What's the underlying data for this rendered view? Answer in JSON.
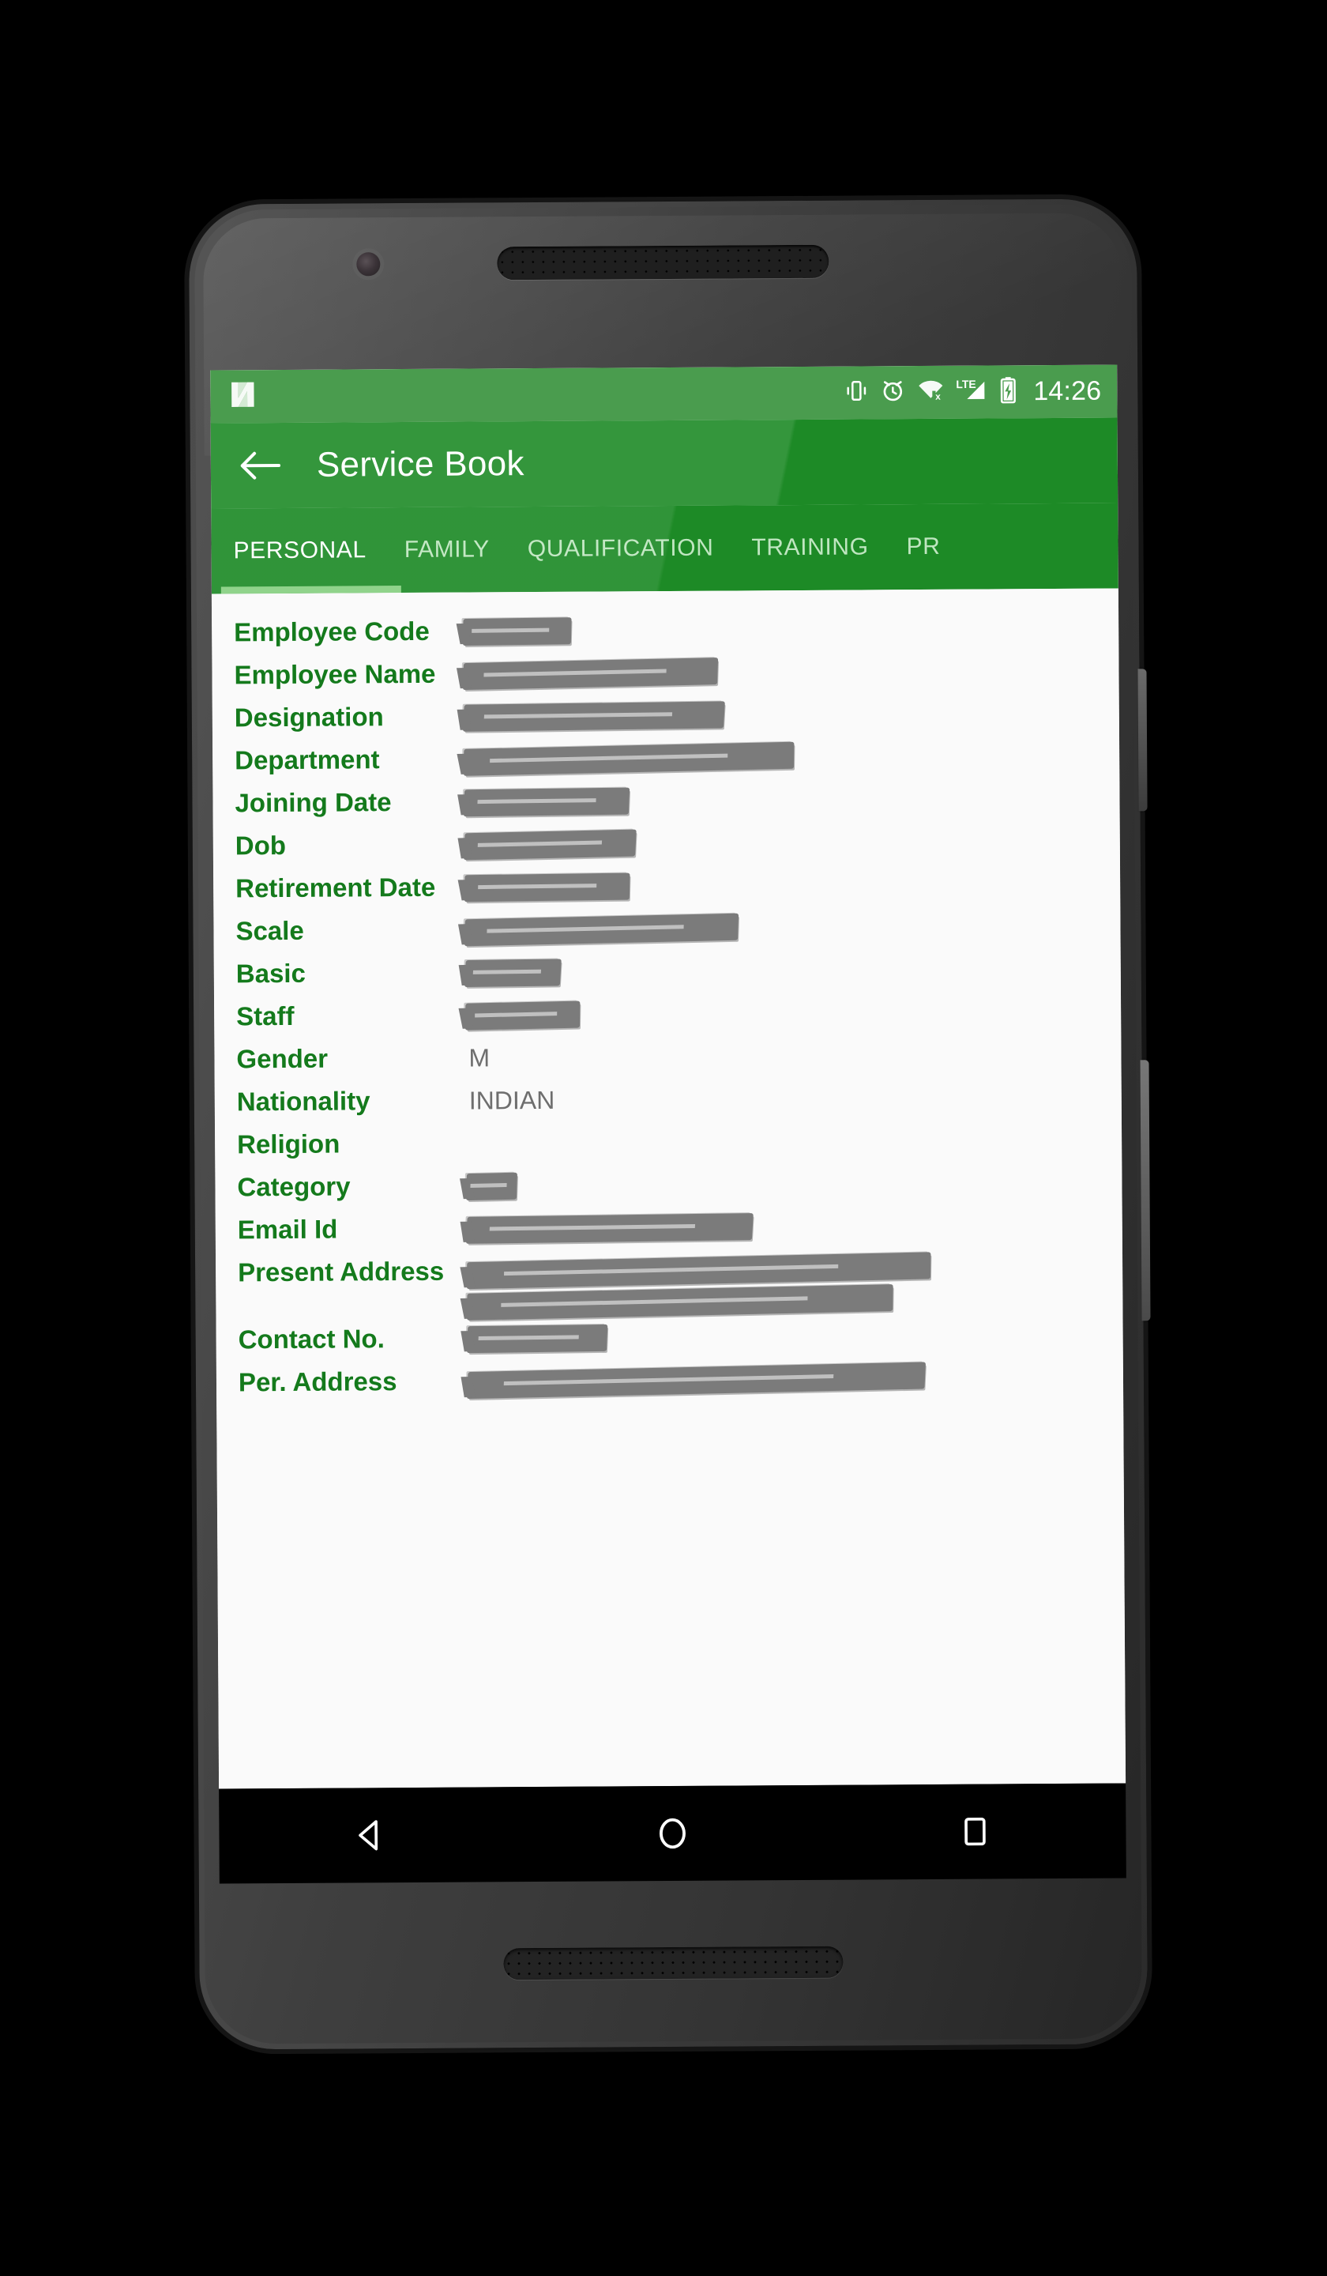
{
  "status_bar": {
    "os_logo": "android-nougat-n-logo",
    "icons": [
      "vibrate-icon",
      "alarm-icon",
      "wifi-off-icon",
      "lte-signal-icon",
      "battery-charging-icon"
    ],
    "lte_label": "LTE",
    "time": "14:26",
    "background_color": "#4a9c4e"
  },
  "app_bar": {
    "back_icon": "back-arrow-icon",
    "title": "Service Book",
    "background_color": "#1d8a26"
  },
  "tabs": {
    "active_index": 0,
    "indicator_color": "#86cf80",
    "items": [
      {
        "label": "PERSONAL"
      },
      {
        "label": "FAMILY"
      },
      {
        "label": "QUALIFICATION"
      },
      {
        "label": "TRAINING"
      },
      {
        "label": "PR"
      }
    ]
  },
  "form": {
    "label_color": "#147a1c",
    "value_color": "#6e6e6e",
    "rows": [
      {
        "label": "Employee Code",
        "value": "",
        "redacted": true,
        "width": "17%",
        "lines": 1
      },
      {
        "label": "Employee Name",
        "value": "",
        "redacted": true,
        "width": "40%",
        "lines": 1
      },
      {
        "label": "Designation",
        "value": "",
        "redacted": true,
        "width": "41%",
        "lines": 1
      },
      {
        "label": "Department",
        "value": "",
        "redacted": true,
        "width": "52%",
        "lines": 1
      },
      {
        "label": "Joining Date",
        "value": "",
        "redacted": true,
        "width": "26%",
        "lines": 1
      },
      {
        "label": "Dob",
        "value": "",
        "redacted": true,
        "width": "27%",
        "lines": 1
      },
      {
        "label": "Retirement Date",
        "value": "",
        "redacted": true,
        "width": "26%",
        "lines": 1
      },
      {
        "label": "Scale",
        "value": "",
        "redacted": true,
        "width": "43%",
        "lines": 1
      },
      {
        "label": "Basic",
        "value": "",
        "redacted": true,
        "width": "15%",
        "lines": 1
      },
      {
        "label": "Staff",
        "value": "",
        "redacted": true,
        "width": "18%",
        "lines": 1
      },
      {
        "label": "Gender",
        "value": "M",
        "redacted": false,
        "width": "",
        "lines": 1
      },
      {
        "label": "Nationality",
        "value": "INDIAN",
        "redacted": false,
        "width": "",
        "lines": 1
      },
      {
        "label": "Religion",
        "value": "",
        "redacted": false,
        "width": "",
        "lines": 1
      },
      {
        "label": "Category",
        "value": "",
        "redacted": true,
        "width": "8%",
        "lines": 1
      },
      {
        "label": "Email Id",
        "value": "",
        "redacted": true,
        "width": "45%",
        "lines": 1
      },
      {
        "label": "Present Address",
        "value": "",
        "redacted": true,
        "width": "73%",
        "lines": 2
      },
      {
        "label": "Contact No.",
        "value": "",
        "redacted": true,
        "width": "22%",
        "lines": 1
      },
      {
        "label": "Per. Address",
        "value": "",
        "redacted": true,
        "width": "72%",
        "lines": 1
      }
    ]
  },
  "nav_bar": {
    "buttons": [
      {
        "name": "back-nav-button",
        "icon": "triangle-back-icon"
      },
      {
        "name": "home-nav-button",
        "icon": "circle-home-icon"
      },
      {
        "name": "recents-nav-button",
        "icon": "square-recents-icon"
      }
    ]
  }
}
